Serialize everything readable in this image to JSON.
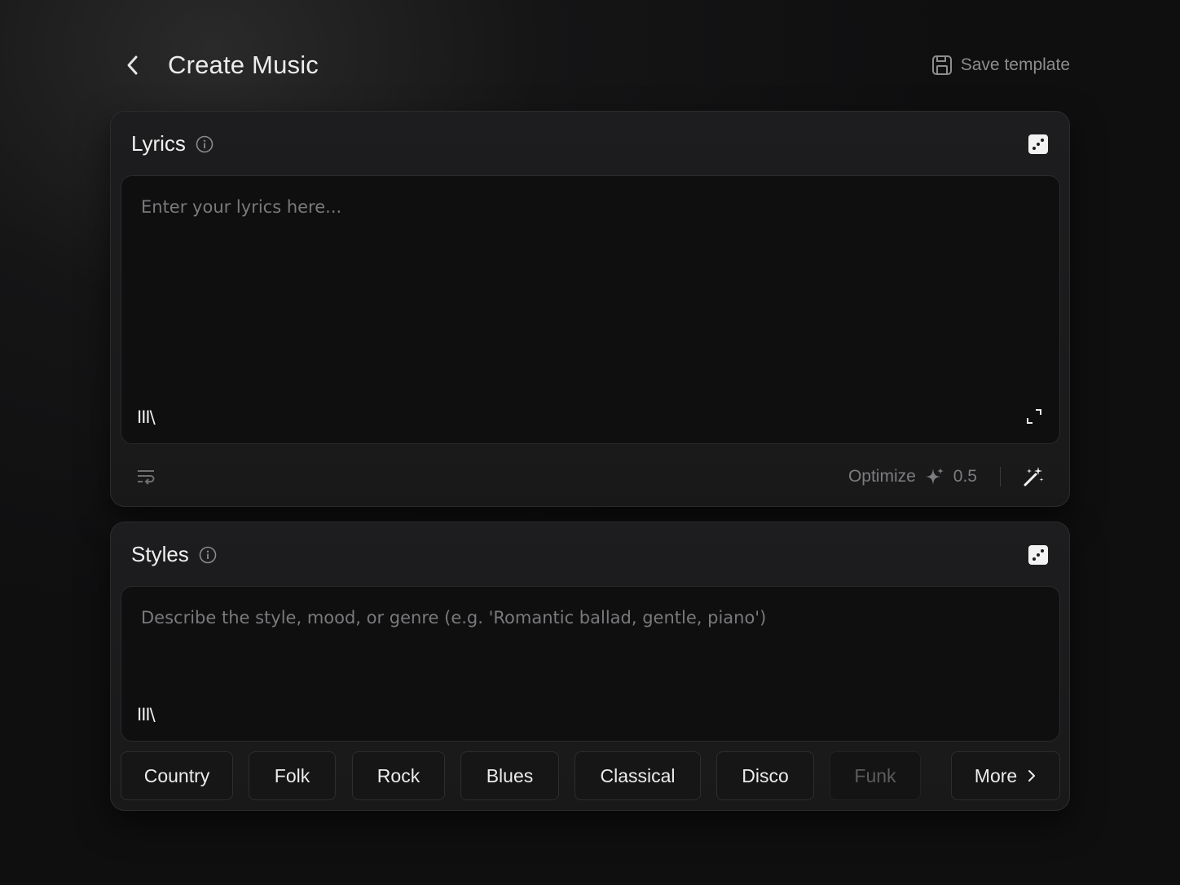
{
  "header": {
    "title": "Create Music",
    "save_label": "Save template"
  },
  "lyrics": {
    "title": "Lyrics",
    "placeholder": "Enter your lyrics here...",
    "library_label": "III\\",
    "optimize_label": "Optimize",
    "cost": "0.5"
  },
  "styles": {
    "title": "Styles",
    "placeholder": "Describe the style, mood, or genre (e.g. 'Romantic ballad, gentle, piano')",
    "library_label": "III\\",
    "chips": [
      "Country",
      "Folk",
      "Rock",
      "Blues",
      "Classical",
      "Disco",
      "Funk"
    ],
    "more_label": "More"
  }
}
